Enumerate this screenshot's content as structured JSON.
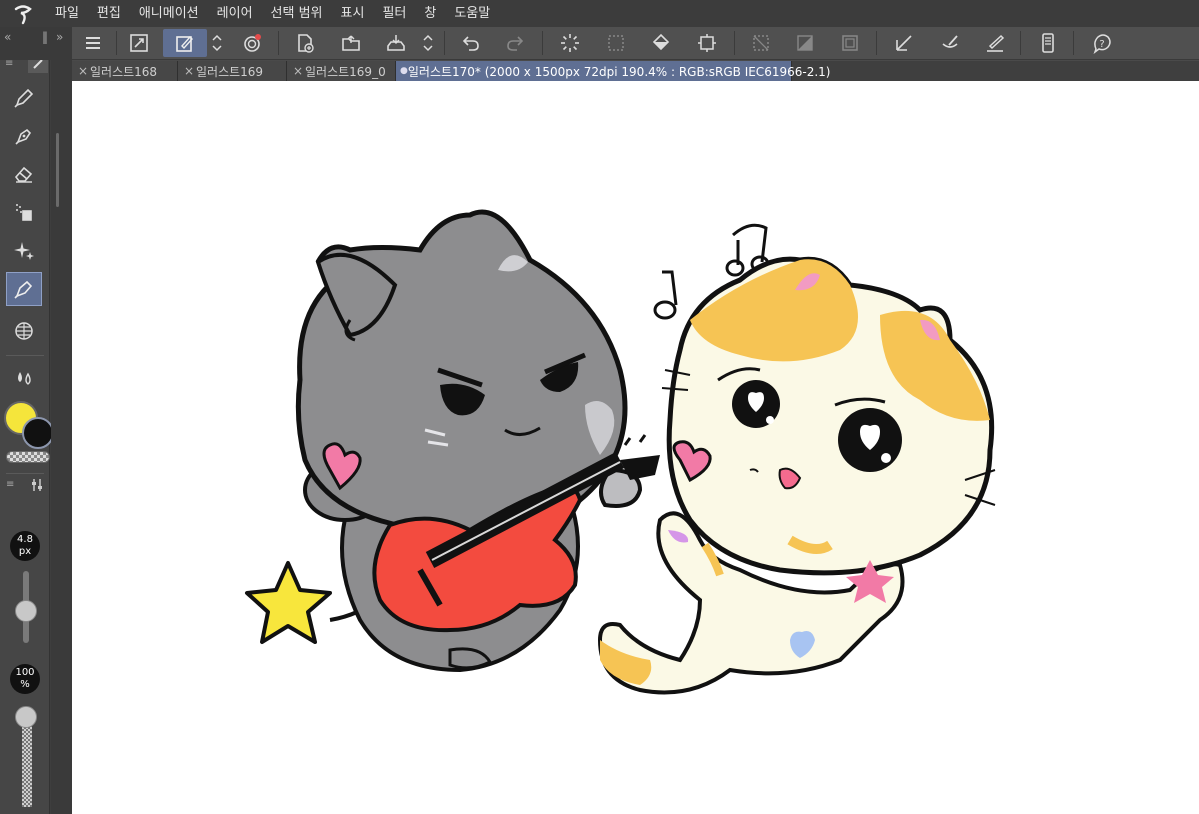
{
  "menu": {
    "items": [
      "파일",
      "편집",
      "애니메이션",
      "레이어",
      "선택 범위",
      "표시",
      "필터",
      "창",
      "도움말"
    ]
  },
  "tabs": [
    {
      "label": "일러스트168",
      "active": false
    },
    {
      "label": "일러스트169",
      "active": false
    },
    {
      "label": "일러스트169_0",
      "active": false
    },
    {
      "label": "일러스트170* (2000 x 1500px 72dpi 190.4% : RGB:sRGB IEC61966-2.1)",
      "active": true
    }
  ],
  "toolbar_icons": [
    "menu-icon",
    "fit-icon",
    "modify-icon",
    "chevron-updown-icon",
    "spiral-icon",
    "new-canvas-icon",
    "open-folder-icon",
    "save-icon",
    "chevron-updown-icon",
    "undo-icon",
    "redo-icon",
    "loading-icon",
    "select-icon",
    "fill-icon",
    "crop-icon",
    "grid-icon",
    "tone-icon",
    "frame-icon",
    "ruler-icon",
    "brush-icon",
    "pen-icon",
    "device-icon",
    "help-icon"
  ],
  "tools": [
    "pen-icon",
    "ink-pen-icon",
    "eraser-icon",
    "spray-icon",
    "sparkle-icon",
    "vector-pen-icon",
    "perspective-icon",
    "blend-icon"
  ],
  "brush": {
    "size_value": "4.8",
    "size_unit": "px",
    "size_level": 0.42,
    "opacity_value": "100",
    "opacity_unit": "%",
    "opacity_level": 1.0
  },
  "colors": {
    "main": "#f5e53b",
    "sub": "#111111",
    "accent": "#5f6f93"
  }
}
